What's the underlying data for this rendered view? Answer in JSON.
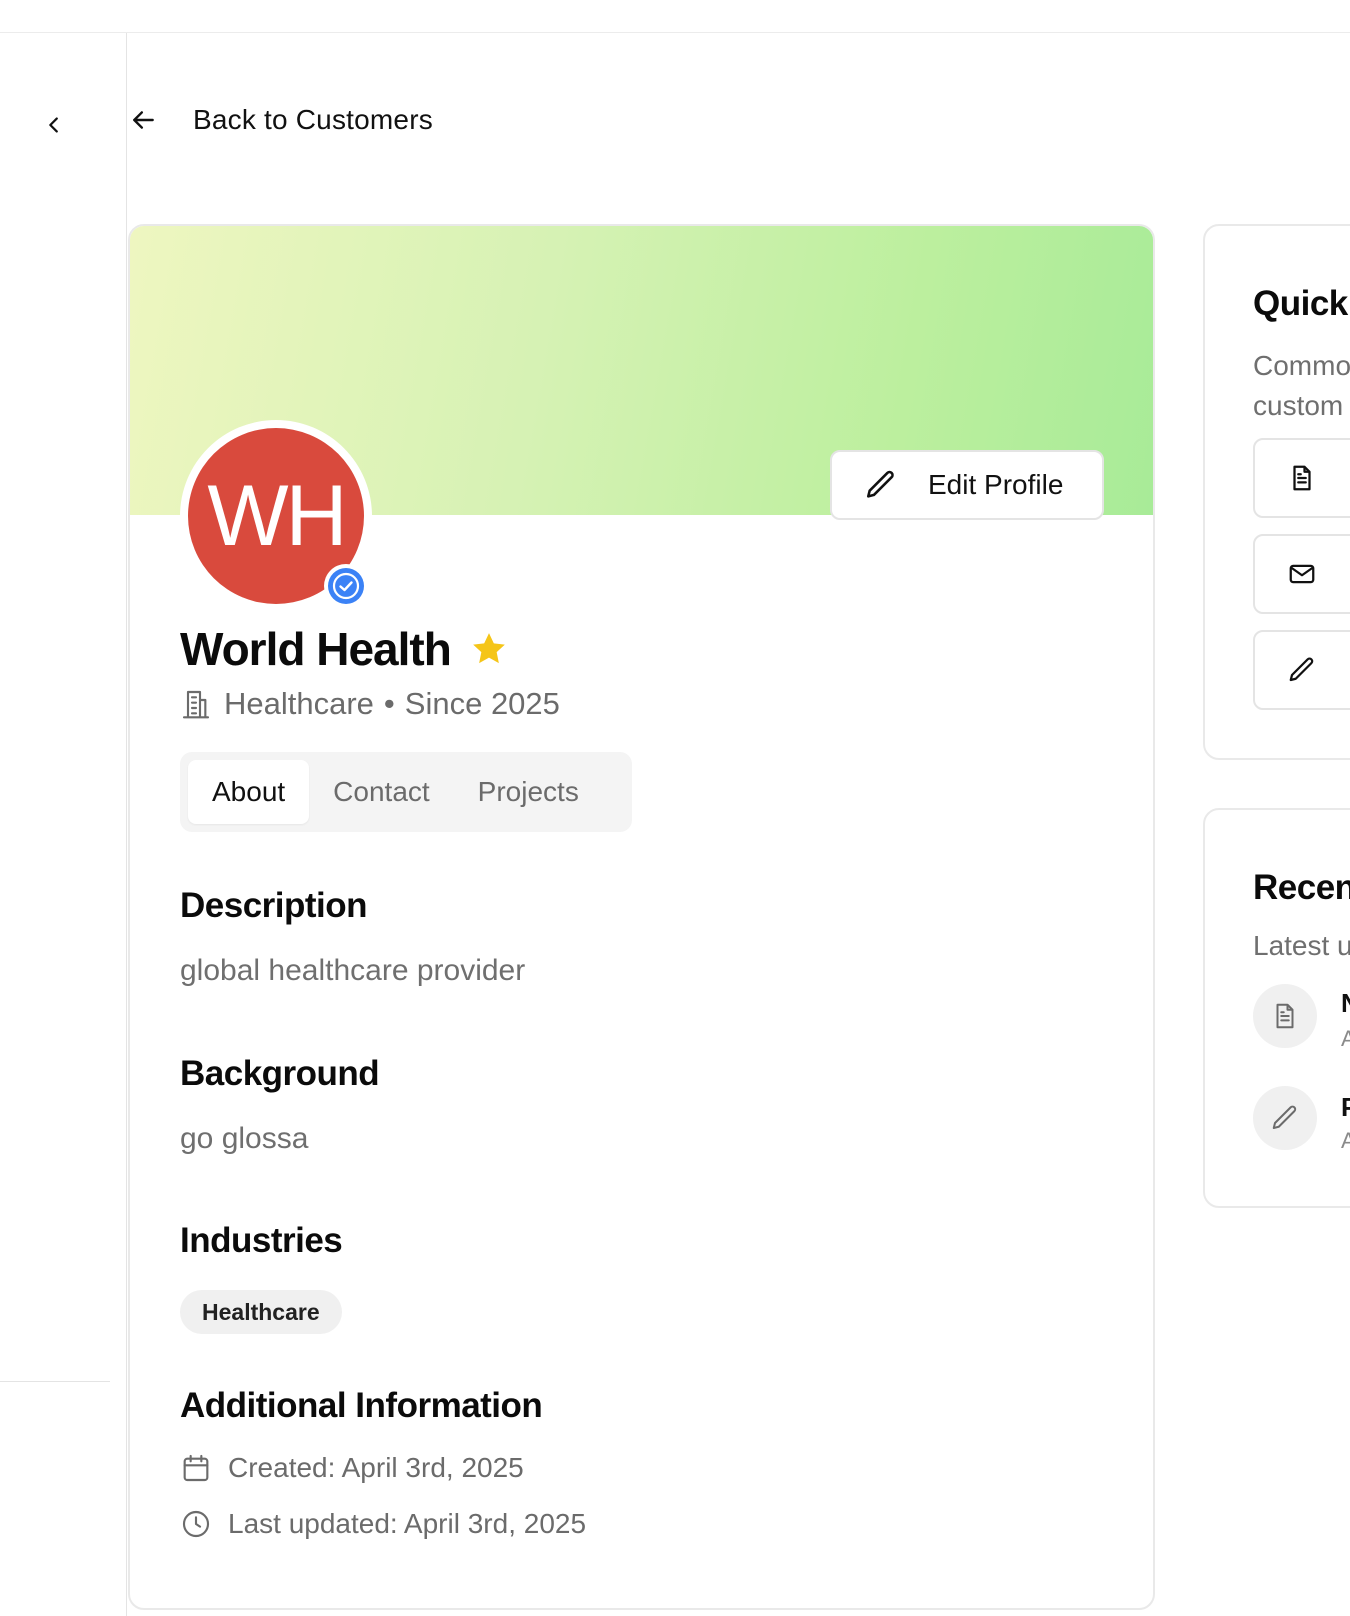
{
  "nav": {
    "back_label": "Back to Customers"
  },
  "profile": {
    "initials": "WH",
    "name": "World Health",
    "industry": "Healthcare",
    "since": "Since 2025",
    "edit_label": "Edit Profile",
    "avatar_color": "#d94a3d",
    "verified_color": "#3b82f6",
    "star_color": "#f5c518"
  },
  "tabs": [
    {
      "label": "About",
      "active": true
    },
    {
      "label": "Contact",
      "active": false
    },
    {
      "label": "Projects",
      "active": false
    }
  ],
  "about": {
    "description_title": "Description",
    "description": "global healthcare provider",
    "background_title": "Background",
    "background": "go glossa",
    "industries_title": "Industries",
    "industries": [
      "Healthcare"
    ],
    "additional_title": "Additional Information",
    "created": "Created: April 3rd, 2025",
    "updated": "Last updated: April 3rd, 2025"
  },
  "quick_actions": {
    "title": "Quick",
    "subtitle_line1": "Commo",
    "subtitle_line2": "custom",
    "actions": [
      {
        "icon": "document-icon"
      },
      {
        "icon": "mail-icon"
      },
      {
        "icon": "pencil-icon"
      }
    ]
  },
  "recent_activity": {
    "title": "Recen",
    "subtitle": "Latest u",
    "items": [
      {
        "icon": "document-icon",
        "title": "N",
        "sub": "A"
      },
      {
        "icon": "pencil-icon",
        "title": "P",
        "sub": "A"
      }
    ]
  }
}
